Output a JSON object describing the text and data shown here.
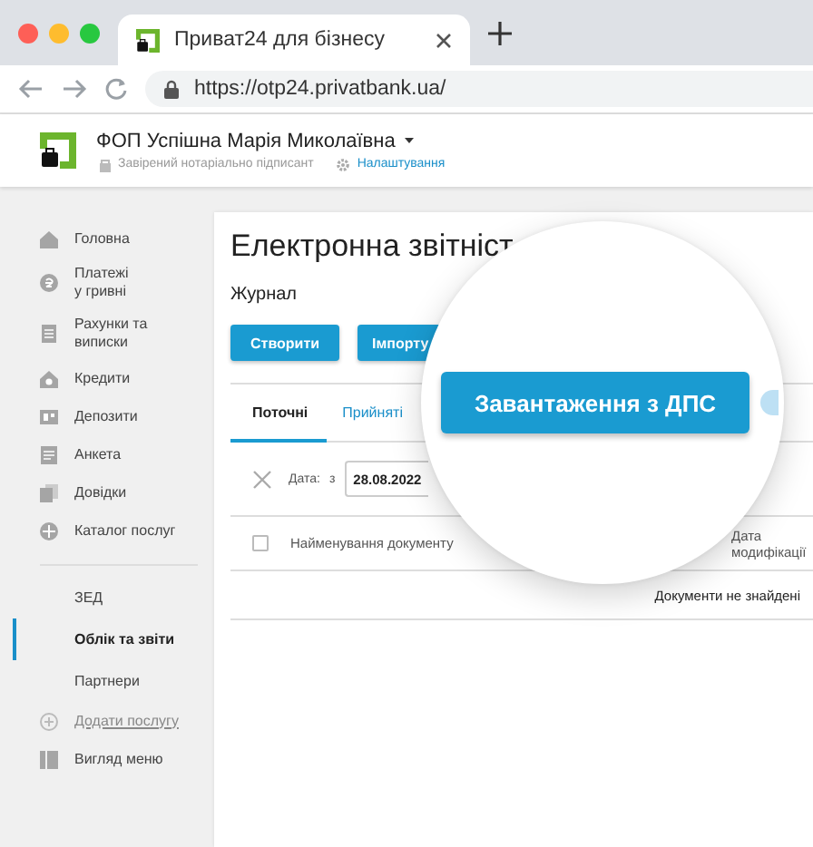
{
  "browser": {
    "tab_title": "Приват24 для бізнесу",
    "url": "https://otp24.privatbank.ua/"
  },
  "header": {
    "account_name": "ФОП Успішна Марія Миколаївна",
    "signer_status": "Завірений нотаріально підписант",
    "settings_link": "Налаштування"
  },
  "sidebar": {
    "items": [
      {
        "label": "Головна",
        "kind": "service",
        "selected": false
      },
      {
        "label": "Платежі\nу гривні",
        "kind": "service",
        "selected": false
      },
      {
        "label": "Рахунки та\nвиписки",
        "kind": "service",
        "selected": false
      },
      {
        "label": "Кредити",
        "kind": "service",
        "selected": false
      },
      {
        "label": "Депозити",
        "kind": "service",
        "selected": false
      },
      {
        "label": "Анкета",
        "kind": "service",
        "selected": false
      },
      {
        "label": "Довідки",
        "kind": "service",
        "selected": false
      },
      {
        "label": "Каталог послуг",
        "kind": "service",
        "selected": false
      },
      {
        "label": "ЗЕД",
        "kind": "section",
        "selected": false
      },
      {
        "label": "Облік та звіти",
        "kind": "section",
        "selected": true
      },
      {
        "label": "Партнери",
        "kind": "section",
        "selected": false
      },
      {
        "label": "Додати послугу",
        "kind": "add",
        "selected": false
      },
      {
        "label": "Вигляд меню",
        "kind": "view",
        "selected": false
      }
    ]
  },
  "main": {
    "title": "Електронна звітніст",
    "subtitle": "Журнал",
    "buttons": [
      "Створити",
      "Імпорту"
    ],
    "tabs": [
      {
        "label": "Поточні",
        "selected": true
      },
      {
        "label": "Прийняті",
        "selected": false
      }
    ],
    "filter": {
      "date_label": "Дата:",
      "from_label": "з",
      "from_value": "28.08.2022"
    },
    "table": {
      "select_all_checked": false,
      "columns": [
        "Найменування документу",
        "Дата модифікації"
      ],
      "empty_message": "Документи не знайдені"
    }
  },
  "magnifier": {
    "button": "Завантаження з ДПС"
  }
}
